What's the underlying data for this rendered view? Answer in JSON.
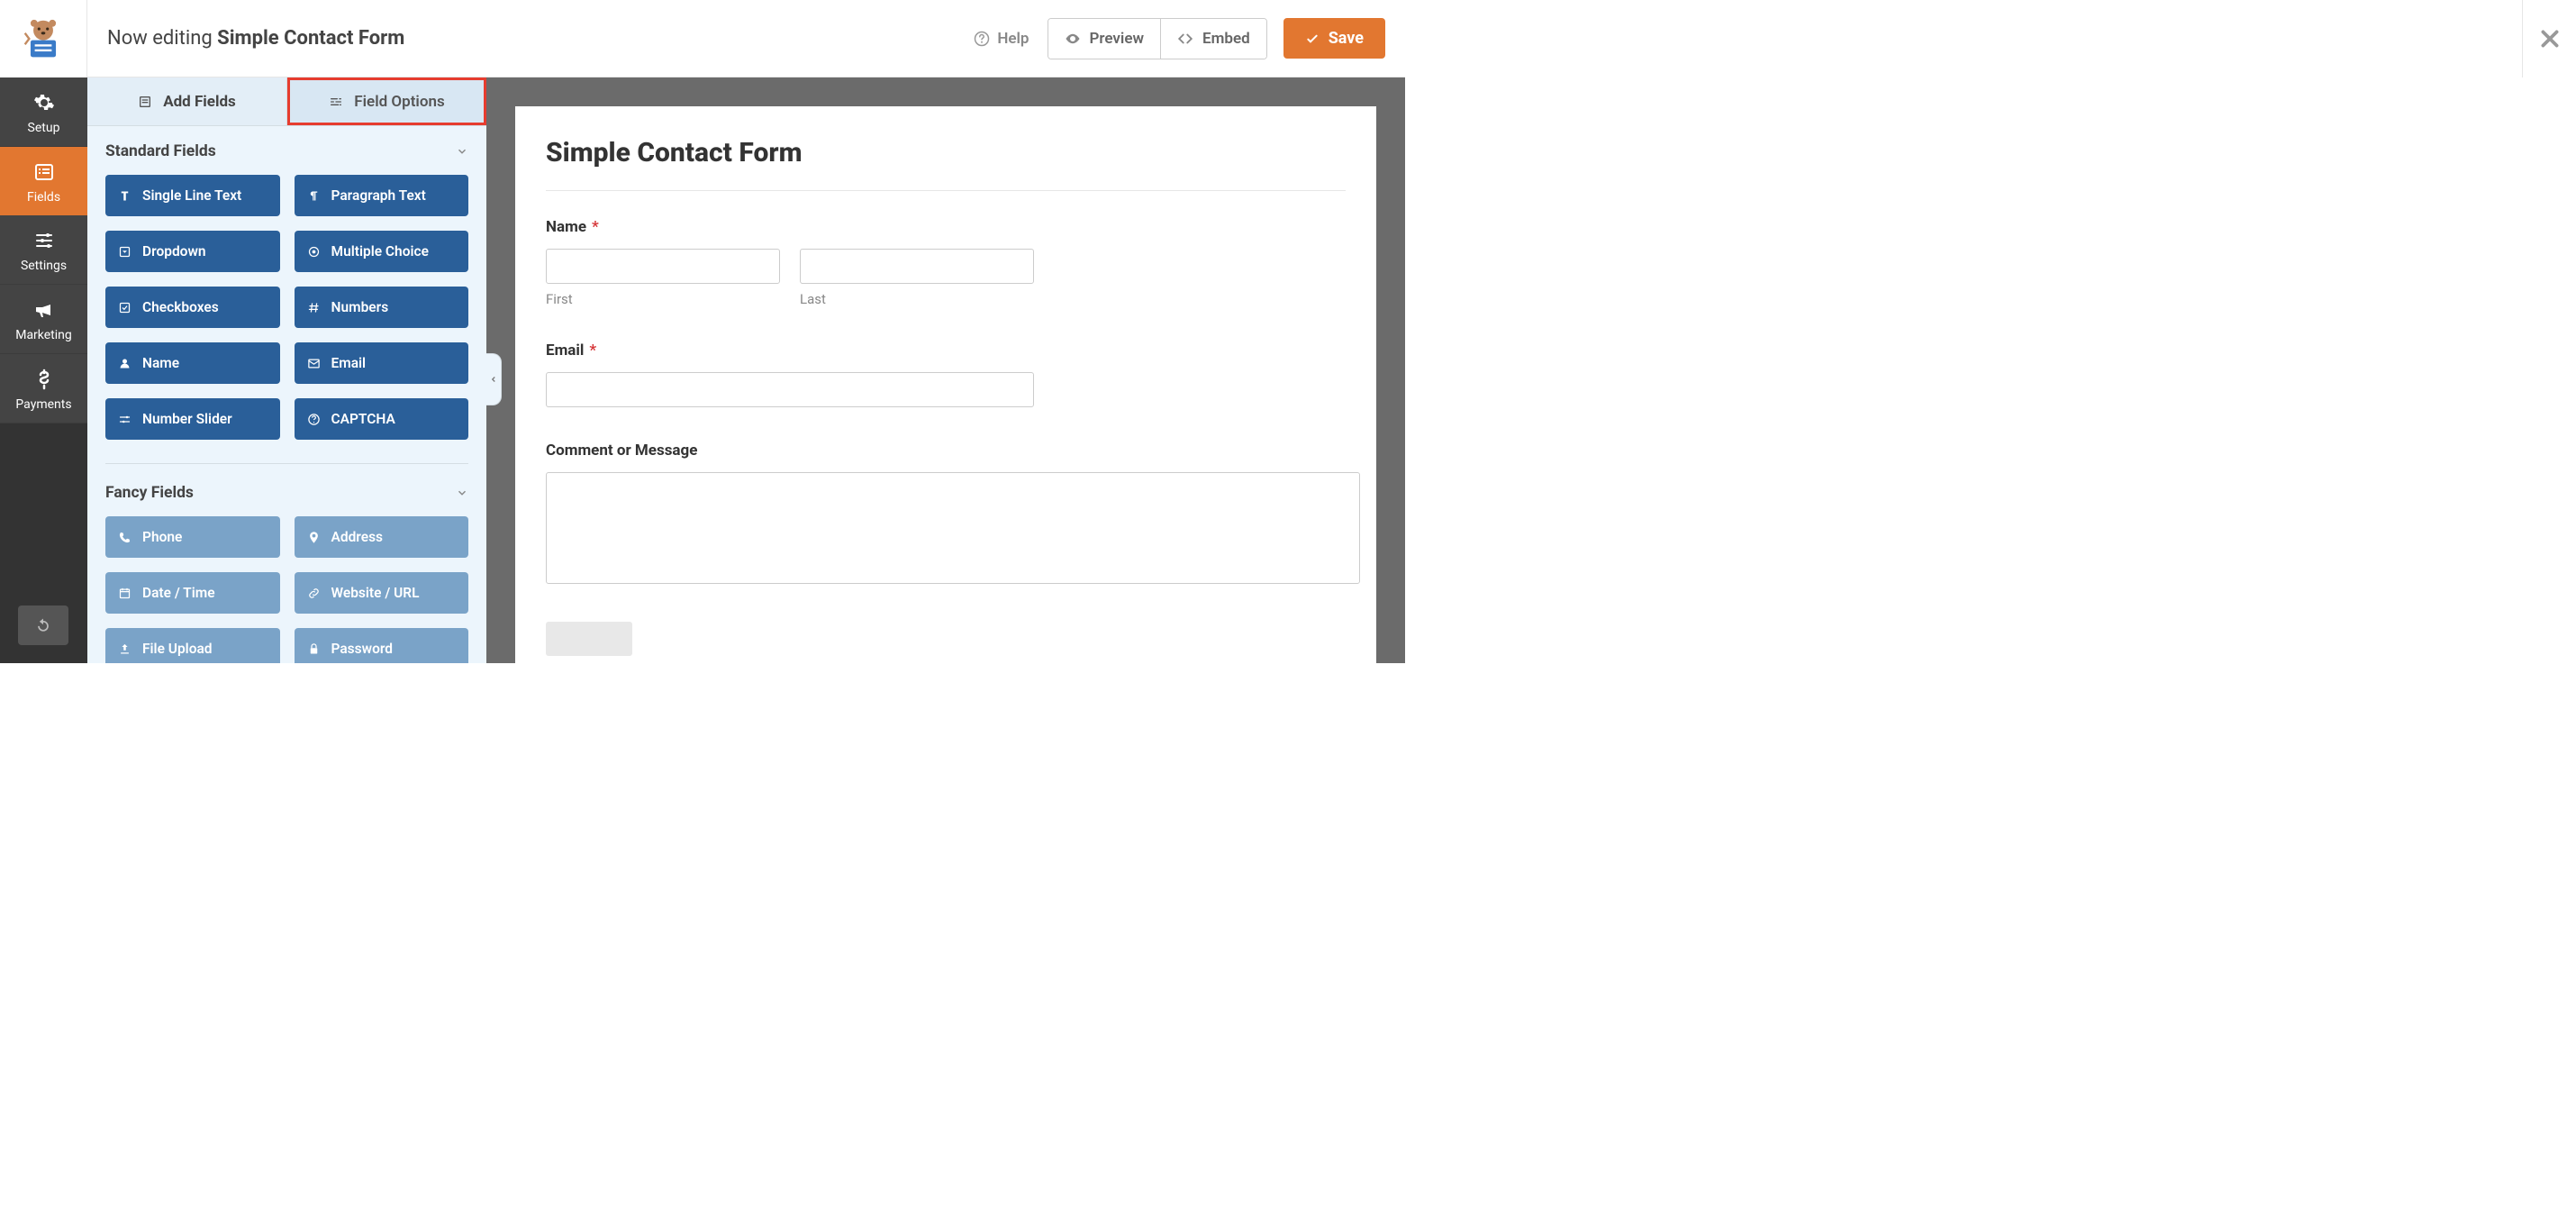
{
  "topbar": {
    "editing_prefix": "Now editing",
    "form_name": "Simple Contact Form",
    "help_label": "Help",
    "preview_label": "Preview",
    "embed_label": "Embed",
    "save_label": "Save"
  },
  "sidenav": {
    "items": [
      {
        "label": "Setup",
        "icon": "gear"
      },
      {
        "label": "Fields",
        "icon": "list"
      },
      {
        "label": "Settings",
        "icon": "sliders"
      },
      {
        "label": "Marketing",
        "icon": "bullhorn"
      },
      {
        "label": "Payments",
        "icon": "dollar"
      }
    ]
  },
  "panel": {
    "tabs": {
      "add_fields": "Add Fields",
      "field_options": "Field Options"
    },
    "sections": [
      {
        "title": "Standard Fields",
        "fields": [
          {
            "label": "Single Line Text",
            "icon": "text"
          },
          {
            "label": "Paragraph Text",
            "icon": "paragraph"
          },
          {
            "label": "Dropdown",
            "icon": "caret-square"
          },
          {
            "label": "Multiple Choice",
            "icon": "radio"
          },
          {
            "label": "Checkboxes",
            "icon": "check-square"
          },
          {
            "label": "Numbers",
            "icon": "hash"
          },
          {
            "label": "Name",
            "icon": "user"
          },
          {
            "label": "Email",
            "icon": "envelope"
          },
          {
            "label": "Number Slider",
            "icon": "sliders"
          },
          {
            "label": "CAPTCHA",
            "icon": "question"
          }
        ]
      },
      {
        "title": "Fancy Fields",
        "faded": true,
        "fields": [
          {
            "label": "Phone",
            "icon": "phone"
          },
          {
            "label": "Address",
            "icon": "marker"
          },
          {
            "label": "Date / Time",
            "icon": "calendar"
          },
          {
            "label": "Website / URL",
            "icon": "link"
          },
          {
            "label": "File Upload",
            "icon": "upload"
          },
          {
            "label": "Password",
            "icon": "lock"
          }
        ]
      }
    ]
  },
  "form_preview": {
    "title": "Simple Contact Form",
    "fields": {
      "name": {
        "label": "Name",
        "required": true,
        "sub_first": "First",
        "sub_last": "Last"
      },
      "email": {
        "label": "Email",
        "required": true
      },
      "comment": {
        "label": "Comment or Message",
        "required": false
      }
    }
  }
}
